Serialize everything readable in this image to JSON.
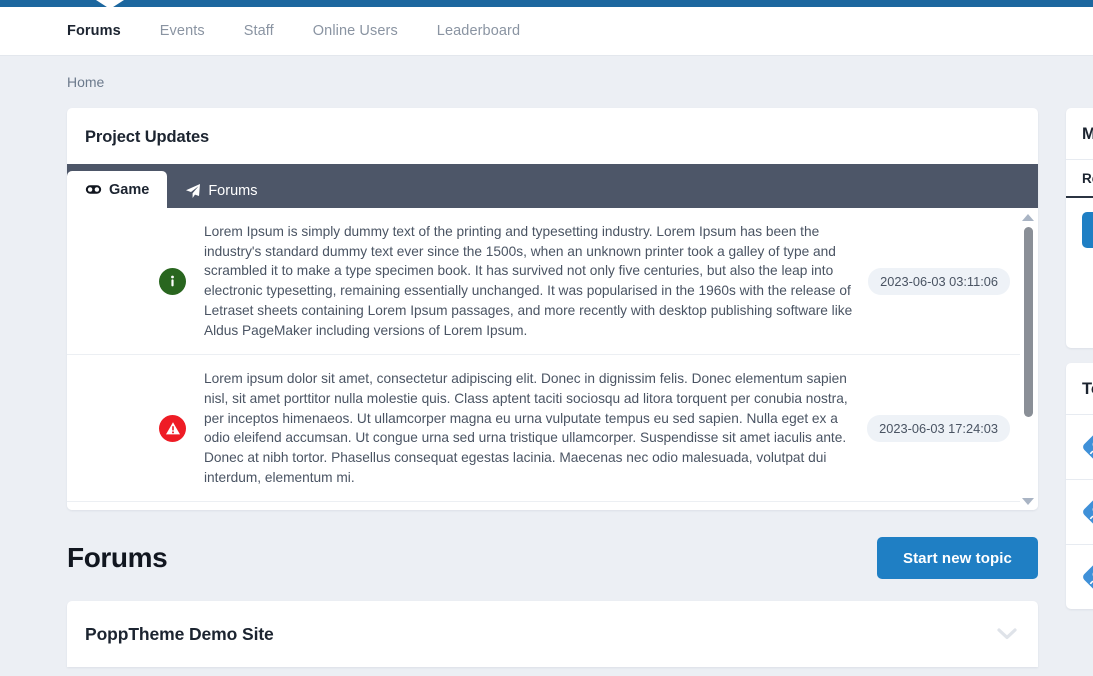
{
  "theme": {
    "accent_blue": "#1c679f",
    "button_blue": "#1f7fc4",
    "tabstrip_dark": "#4d5668",
    "page_bg": "#eceff4",
    "info_green": "#29661f",
    "danger_red": "#ee1c25"
  },
  "nav": {
    "items": [
      {
        "label": "Forums",
        "active": true
      },
      {
        "label": "Events",
        "active": false
      },
      {
        "label": "Staff",
        "active": false
      },
      {
        "label": "Online Users",
        "active": false
      },
      {
        "label": "Leaderboard",
        "active": false
      }
    ]
  },
  "breadcrumb": {
    "home": "Home"
  },
  "updates_card": {
    "title": "Project Updates",
    "tabs": [
      {
        "label": "Game",
        "icon": "gamepad-icon",
        "active": true
      },
      {
        "label": "Forums",
        "icon": "paper-plane-icon",
        "active": false
      }
    ],
    "rows": [
      {
        "severity": "info",
        "icon": "info-circle-icon",
        "text": "Lorem Ipsum is simply dummy text of the printing and typesetting industry. Lorem Ipsum has been the industry's standard dummy text ever since the 1500s, when an unknown printer took a galley of type and scrambled it to make a type specimen book. It has survived not only five centuries, but also the leap into electronic typesetting, remaining essentially unchanged. It was popularised in the 1960s with the release of Letraset sheets containing Lorem Ipsum passages, and more recently with desktop publishing software like Aldus PageMaker including versions of Lorem Ipsum.",
        "timestamp": "2023-06-03 03:11:06"
      },
      {
        "severity": "danger",
        "icon": "warning-triangle-icon",
        "text": "Lorem ipsum dolor sit amet, consectetur adipiscing elit. Donec in dignissim felis. Donec elementum sapien nisl, sit amet porttitor nulla molestie quis. Class aptent taciti sociosqu ad litora torquent per conubia nostra, per inceptos himenaeos. Ut ullamcorper magna eu urna vulputate tempus eu sed sapien. Nulla eget ex a odio eleifend accumsan. Ut congue urna sed urna tristique ullamcorper. Suspendisse sit amet iaculis ante. Donec at nibh tortor. Phasellus consequat egestas lacinia. Maecenas nec odio malesuada, volutpat dui interdum, elementum mi.",
        "timestamp": "2023-06-03 17:24:03"
      }
    ]
  },
  "forums_section": {
    "heading": "Forums",
    "start_topic_button": "Start new topic",
    "group_title": "PoppTheme Demo Site"
  },
  "sidebar": {
    "card_one": {
      "title": "Mo",
      "tab": "Re",
      "button": ""
    },
    "card_two": {
      "title": "To",
      "items": [
        {
          "icon": "user-avatar-icon"
        },
        {
          "icon": "user-avatar-icon"
        },
        {
          "icon": "user-avatar-icon"
        }
      ]
    }
  }
}
